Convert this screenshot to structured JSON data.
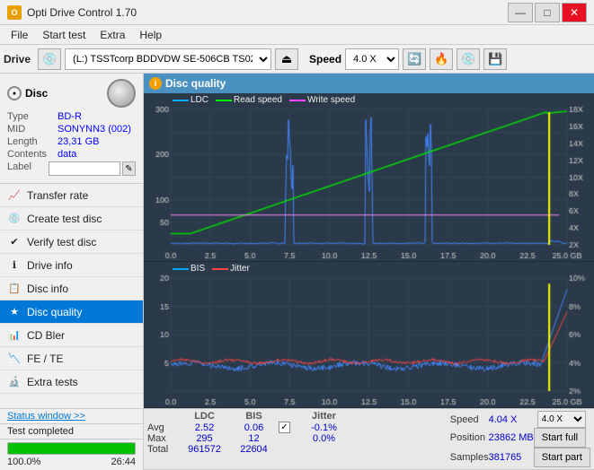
{
  "app": {
    "title": "Opti Drive Control 1.70",
    "icon": "O"
  },
  "title_controls": {
    "minimize": "—",
    "maximize": "□",
    "close": "✕"
  },
  "menu": {
    "items": [
      "File",
      "Start test",
      "Extra",
      "Help"
    ]
  },
  "toolbar": {
    "drive_label": "Drive",
    "drive_value": "(L:) TSSTcorp BDDVDW SE-506CB TS02",
    "speed_label": "Speed",
    "speed_value": "4.0 X"
  },
  "disc": {
    "title": "Disc",
    "type_label": "Type",
    "type_value": "BD-R",
    "mid_label": "MID",
    "mid_value": "SONYNN3 (002)",
    "length_label": "Length",
    "length_value": "23,31 GB",
    "contents_label": "Contents",
    "contents_value": "data",
    "label_label": "Label",
    "label_value": ""
  },
  "nav": {
    "items": [
      {
        "id": "transfer-rate",
        "label": "Transfer rate",
        "icon": "📈"
      },
      {
        "id": "create-test-disc",
        "label": "Create test disc",
        "icon": "💿"
      },
      {
        "id": "verify-test-disc",
        "label": "Verify test disc",
        "icon": "✔"
      },
      {
        "id": "drive-info",
        "label": "Drive info",
        "icon": "ℹ"
      },
      {
        "id": "disc-info",
        "label": "Disc info",
        "icon": "📋"
      },
      {
        "id": "disc-quality",
        "label": "Disc quality",
        "icon": "★",
        "active": true
      },
      {
        "id": "cd-bler",
        "label": "CD Bler",
        "icon": "📊"
      },
      {
        "id": "fe-te",
        "label": "FE / TE",
        "icon": "📉"
      },
      {
        "id": "extra-tests",
        "label": "Extra tests",
        "icon": "🔬"
      }
    ],
    "status_window": "Status window >>",
    "status_text": "Test completed"
  },
  "progress": {
    "percent": 100,
    "time": "26:44",
    "percent_label": "100.0%"
  },
  "disc_quality": {
    "title": "Disc quality",
    "chart1": {
      "legend": [
        {
          "label": "LDC",
          "color": "#00aaff"
        },
        {
          "label": "Read speed",
          "color": "#00ff00"
        },
        {
          "label": "Write speed",
          "color": "#ff44ff"
        }
      ],
      "y_left_max": 300,
      "y_right_labels": [
        "18X",
        "16X",
        "14X",
        "12X",
        "10X",
        "8X",
        "6X",
        "4X",
        "2X"
      ],
      "x_labels": [
        "0.0",
        "2.5",
        "5.0",
        "7.5",
        "10.0",
        "12.5",
        "15.0",
        "17.5",
        "20.0",
        "22.5",
        "25.0 GB"
      ]
    },
    "chart2": {
      "legend": [
        {
          "label": "BIS",
          "color": "#00aaff"
        },
        {
          "label": "Jitter",
          "color": "#ff4444"
        }
      ],
      "y_left_max": 20,
      "y_right_labels": [
        "10%",
        "8%",
        "6%",
        "4%",
        "2%"
      ],
      "x_labels": [
        "0.0",
        "2.5",
        "5.0",
        "7.5",
        "10.0",
        "12.5",
        "15.0",
        "17.5",
        "20.0",
        "22.5",
        "25.0 GB"
      ]
    },
    "stats": {
      "headers": [
        "LDC",
        "BIS",
        "",
        "Jitter",
        "Speed",
        "",
        ""
      ],
      "avg_label": "Avg",
      "avg_ldc": "2.52",
      "avg_bis": "0.06",
      "avg_jitter": "-0.1%",
      "avg_speed": "4.04 X",
      "max_label": "Max",
      "max_ldc": "295",
      "max_bis": "12",
      "max_jitter": "0.0%",
      "pos_label": "Position",
      "pos_value": "23862 MB",
      "total_label": "Total",
      "total_ldc": "961572",
      "total_bis": "22604",
      "samples_label": "Samples",
      "samples_value": "381765",
      "speed_select": "4.0 X",
      "start_full": "Start full",
      "start_part": "Start part",
      "jitter_checked": true
    }
  }
}
